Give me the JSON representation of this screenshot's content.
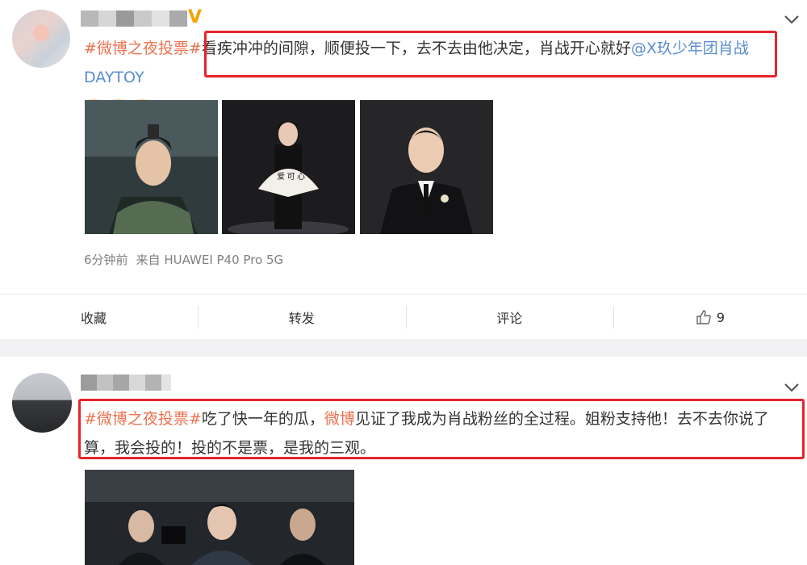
{
  "post1": {
    "text_topic": "#微博之夜投票#",
    "text_body": "看疾冲冲的间隙，顺便投一下，去不去由他决定，肖战开心就好",
    "text_mention": "@X玖少年团肖战DAYTOY",
    "emojis": [
      "doge-emoji",
      "doge-emoji",
      "doge-emoji"
    ],
    "time": "6分钟前",
    "source": "来自 HUAWEI P40 Pro 5G",
    "actions": {
      "favorite": "收藏",
      "repost": "转发",
      "comment": "评论",
      "like_count": "9"
    },
    "images": [
      "photo-armored-warrior",
      "photo-stage-fan",
      "photo-stage-suit"
    ]
  },
  "post2": {
    "text_topic": "#微博之夜投票#",
    "text_a": "吃了快一年的瓜，",
    "text_keyword": "微博",
    "text_b": "见证了我成为肖战粉丝的全过程。姐粉支持他！去不去你说了算，我会投的！投的不是票，是我的三观。",
    "images": [
      "photo-group-backstage"
    ]
  },
  "colors": {
    "topic": "#eb7350",
    "mention": "#5b8dcf",
    "highlight_box": "#e8232a",
    "verified": "#f4a300",
    "separator": "#f2f2f5"
  }
}
